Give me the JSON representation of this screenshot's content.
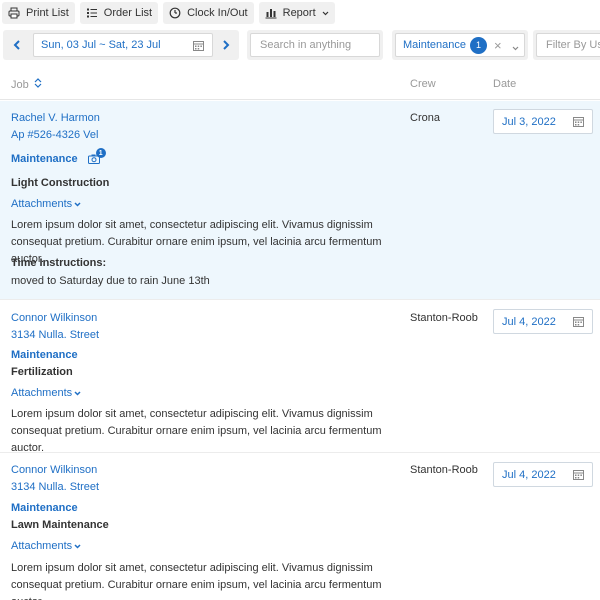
{
  "toolbar": {
    "print_label": "Print List",
    "order_label": "Order List",
    "clock_label": "Clock In/Out",
    "report_label": "Report"
  },
  "filters": {
    "date_range": "Sun, 03 Jul ~ Sat, 23 Jul",
    "search_placeholder": "Search in anything",
    "job_type": "Maintenance",
    "job_type_count": "1",
    "user_placeholder": "Filter By User"
  },
  "table": {
    "col_job": "Job",
    "col_crew": "Crew",
    "col_date": "Date"
  },
  "rows": [
    {
      "client": "Rachel V. Harmon",
      "address": "Ap #526-4326 Vel",
      "type": "Maintenance",
      "photo_count": "1",
      "service": "Light Construction",
      "attachments": "Attachments",
      "description": "Lorem ipsum dolor sit amet, consectetur adipiscing elit. Vivamus dignissim consequat pretium. Curabitur ornare enim ipsum, vel lacinia arcu fermentum auctor.",
      "time_label": "Time Instructions:",
      "time_text": "moved to Saturday due to rain June 13th",
      "crew": "Crona",
      "date": "Jul 3, 2022"
    },
    {
      "client": "Connor Wilkinson",
      "address": "3134 Nulla. Street",
      "type": "Maintenance",
      "service": "Fertilization",
      "attachments": "Attachments",
      "description": "Lorem ipsum dolor sit amet, consectetur adipiscing elit. Vivamus dignissim consequat pretium. Curabitur ornare enim ipsum, vel lacinia arcu fermentum auctor.",
      "crew": "Stanton-Roob",
      "date": "Jul 4, 2022"
    },
    {
      "client": "Connor Wilkinson",
      "address": "3134 Nulla. Street",
      "type": "Maintenance",
      "service": "Lawn Maintenance",
      "attachments": "Attachments",
      "description": "Lorem ipsum dolor sit amet, consectetur adipiscing elit. Vivamus dignissim consequat pretium. Curabitur ornare enim ipsum, vel lacinia arcu fermentum auctor.",
      "crew": "Stanton-Roob",
      "date": "Jul 4, 2022"
    }
  ],
  "colors": {
    "accent": "#1f6fc5",
    "selected_row": "#eef7fd",
    "toolbar_bg": "#f0f0f0"
  },
  "icons": [
    "printer-icon",
    "list-order-icon",
    "clock-icon",
    "bar-chart-icon",
    "chevron-down-icon",
    "chevron-left-icon",
    "chevron-right-icon",
    "calendar-icon",
    "close-icon",
    "sort-icon",
    "camera-icon"
  ]
}
